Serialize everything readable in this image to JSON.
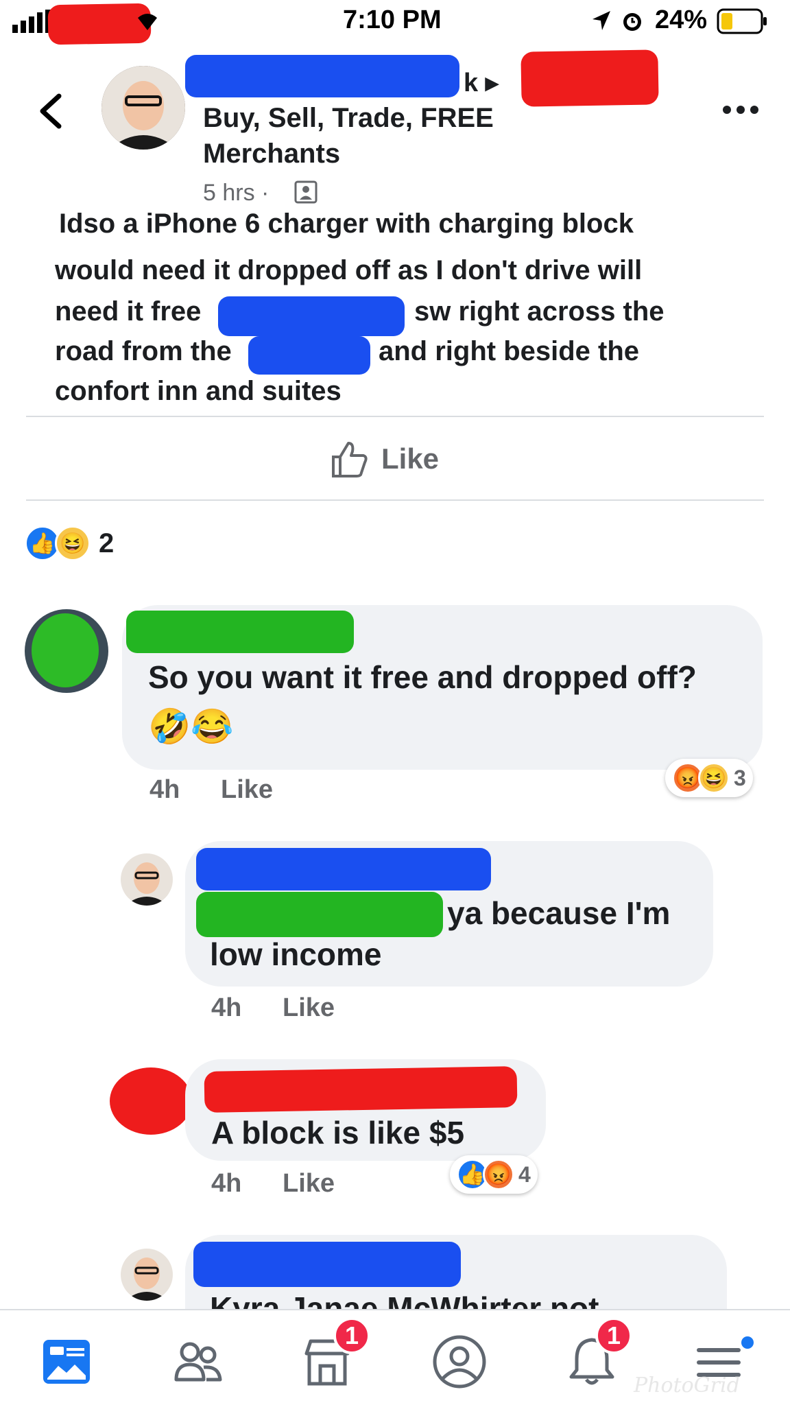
{
  "status_bar": {
    "time": "7:10 PM",
    "battery": "24%"
  },
  "post": {
    "group_line1": "Buy, Sell, Trade, FREE",
    "group_line2": "Merchants",
    "time": "5 hrs ·",
    "text_lines": [
      "Idso a iPhone 6 charger with charging block",
      "would need it dropped off as I don't drive will",
      "need it free",
      "sw right across the",
      "road from the",
      "and right beside the",
      "confort inn and suites"
    ],
    "like_label": "Like",
    "reaction_count": "2"
  },
  "comments": [
    {
      "text": "So you want it free and dropped off?",
      "emoji": "🤣😂",
      "time": "4h",
      "like": "Like",
      "reactions": "3"
    },
    {
      "text1": "ya because I'm",
      "text2": "low income",
      "time": "4h",
      "like": "Like"
    },
    {
      "text": "A block is like $5",
      "time": "4h",
      "like": "Like",
      "reactions": "4"
    },
    {
      "text": "Kyra Janae McWhirter not"
    }
  ],
  "nav": {
    "groups_badge": "1",
    "notifications_badge": "1",
    "watermark": "PhotoGrid"
  },
  "colors": {
    "fb_blue": "#1877f2",
    "badge_red": "#f02849",
    "bubble": "#f0f2f5"
  }
}
